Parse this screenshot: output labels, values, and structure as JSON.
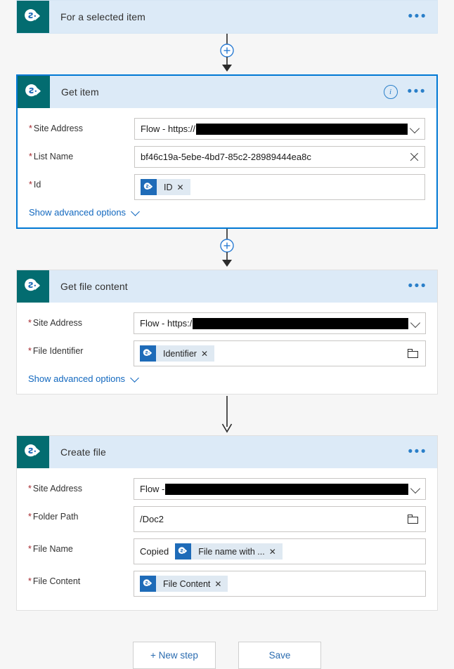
{
  "flow": {
    "steps": [
      {
        "id": "for-a-selected-item",
        "title": "For a selected item",
        "icon": "sharepoint-icon",
        "collapsed": true,
        "selected": false,
        "has_info": false,
        "fields": []
      },
      {
        "id": "get-item",
        "title": "Get item",
        "icon": "sharepoint-icon",
        "collapsed": false,
        "selected": true,
        "has_info": true,
        "advanced_label": "Show advanced options",
        "fields": [
          {
            "label": "Site Address",
            "required": true,
            "type": "dropdown",
            "prefix": "Flow - https://",
            "redacted": true,
            "value": ""
          },
          {
            "label": "List Name",
            "required": true,
            "type": "text-clearable",
            "value": "bf46c19a-5ebe-4bd7-85c2-28989444ea8c"
          },
          {
            "label": "Id",
            "required": true,
            "type": "token",
            "prefix": "",
            "token_label": "ID"
          }
        ]
      },
      {
        "id": "get-file-content",
        "title": "Get file content",
        "icon": "sharepoint-icon",
        "collapsed": false,
        "selected": false,
        "has_info": false,
        "advanced_label": "Show advanced options",
        "fields": [
          {
            "label": "Site Address",
            "required": true,
            "type": "dropdown",
            "prefix": "Flow - https:/",
            "redacted": true,
            "value": ""
          },
          {
            "label": "File Identifier",
            "required": true,
            "type": "token-folder",
            "prefix": "",
            "token_label": "Identifier"
          }
        ]
      },
      {
        "id": "create-file",
        "title": "Create file",
        "icon": "sharepoint-icon",
        "collapsed": false,
        "selected": false,
        "has_info": false,
        "advanced_label": "",
        "fields": [
          {
            "label": "Site Address",
            "required": true,
            "type": "dropdown",
            "prefix": "Flow - ",
            "redacted": true,
            "value": ""
          },
          {
            "label": "Folder Path",
            "required": true,
            "type": "text-folder",
            "value": "/Doc2"
          },
          {
            "label": "File Name",
            "required": true,
            "type": "token",
            "prefix": "Copied",
            "token_label": "File name with ..."
          },
          {
            "label": "File Content",
            "required": true,
            "type": "token",
            "prefix": "",
            "token_label": "File Content"
          }
        ]
      }
    ],
    "connectors": [
      {
        "has_plus": true
      },
      {
        "has_plus": true
      },
      {
        "has_plus": false
      }
    ]
  },
  "footer": {
    "new_step_label": "+ New step",
    "save_label": "Save"
  },
  "icons": {
    "info": "i",
    "ellipsis": "•••",
    "token_x": "✕"
  },
  "colors": {
    "accent": "#0078d4",
    "header_bg": "#dceaf7",
    "sharepoint_tile": "#036c70",
    "token_bg": "#dfe9f2",
    "required_asterisk": "#a4262c",
    "link": "#1268bf",
    "page_bg": "#f6f6f6"
  }
}
